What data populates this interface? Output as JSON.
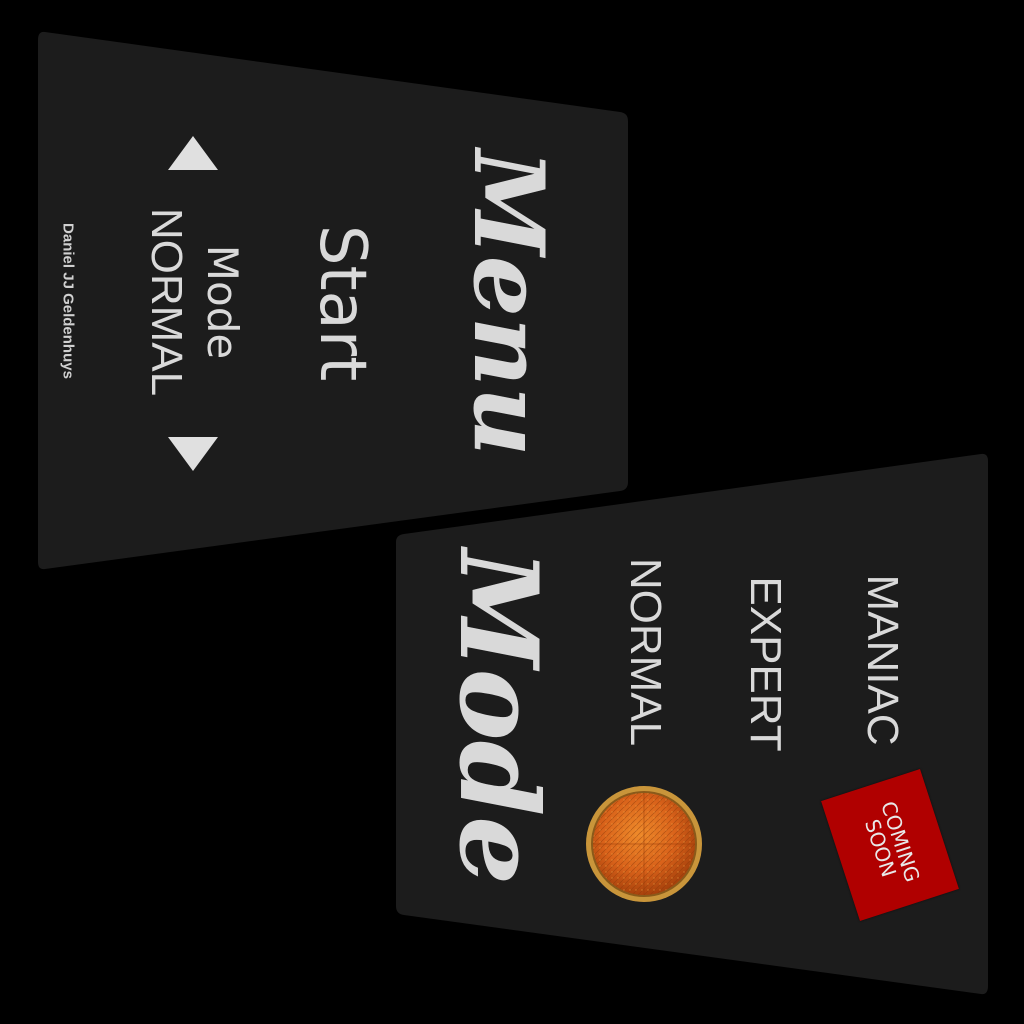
{
  "menu_panel": {
    "title": "Menu",
    "start_label": "Start",
    "mode_label": "Mode",
    "mode_value": "NORMAL",
    "up_arrow_icon": "triangle-up-icon",
    "down_arrow_icon": "triangle-down-icon",
    "credit": "Daniel JJ Geldenhuys"
  },
  "mode_panel": {
    "title": "Mode",
    "options": [
      {
        "label": "NORMAL",
        "selected": true
      },
      {
        "label": "EXPERT",
        "selected": false
      },
      {
        "label": "MANIAC",
        "selected": false
      }
    ],
    "selector_icon": "orange-orb-icon",
    "coming_soon_label": "COMING SOON"
  },
  "colors": {
    "background": "#000000",
    "panel": "#1c1c1c",
    "text": "#d6d6d6",
    "badge_red": "#b00000",
    "orb_orange": "#d9621a",
    "orb_rim": "#c9953a"
  }
}
